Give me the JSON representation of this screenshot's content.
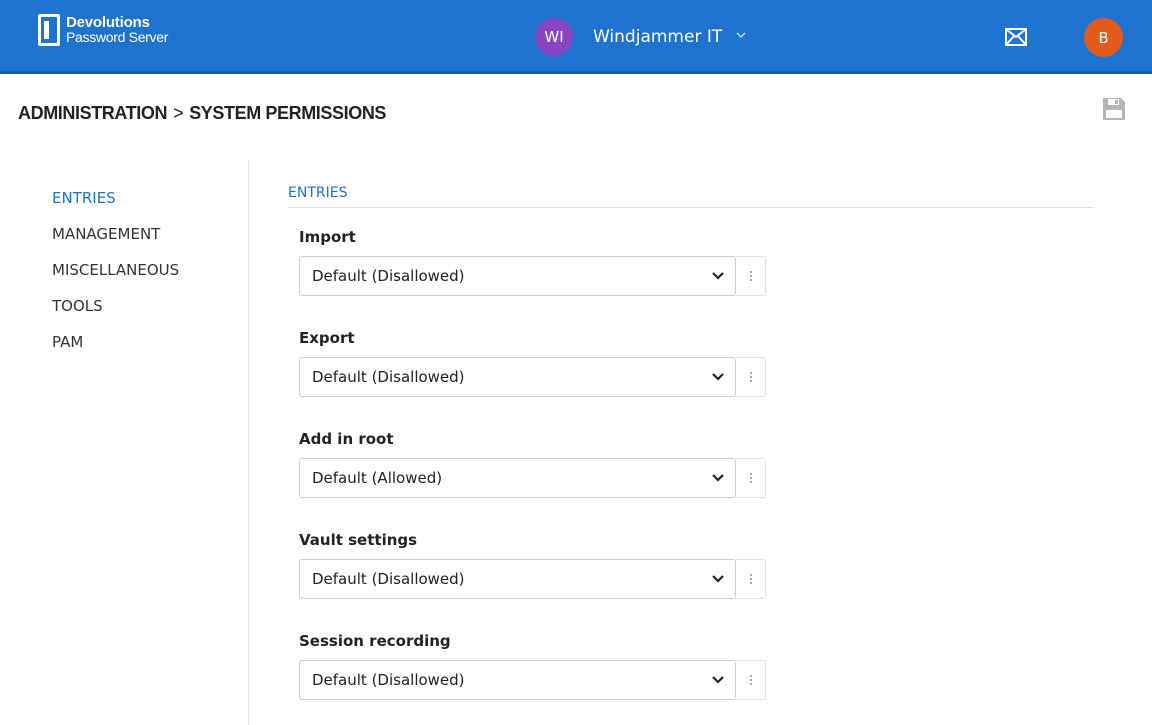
{
  "brand": {
    "line1": "Devolutions",
    "line2": "Password Server"
  },
  "organization": {
    "initials": "WI",
    "name": "Windjammer IT",
    "avatar_color": "#8a44c2"
  },
  "user": {
    "initial": "B",
    "avatar_color": "#e25a1c"
  },
  "colors": {
    "topbar": "#1e73cf",
    "accent": "#1e73cf"
  },
  "breadcrumb": {
    "parent": "ADMINISTRATION",
    "separator": ">",
    "current": "SYSTEM PERMISSIONS"
  },
  "sidenav": {
    "items": [
      {
        "label": "ENTRIES",
        "active": true
      },
      {
        "label": "MANAGEMENT",
        "active": false
      },
      {
        "label": "MISCELLANEOUS",
        "active": false
      },
      {
        "label": "TOOLS",
        "active": false
      },
      {
        "label": "PAM",
        "active": false
      }
    ]
  },
  "section": {
    "title": "ENTRIES",
    "fields": [
      {
        "label": "Import",
        "value": "Default (Disallowed)"
      },
      {
        "label": "Export",
        "value": "Default (Disallowed)"
      },
      {
        "label": "Add in root",
        "value": "Default (Allowed)"
      },
      {
        "label": "Vault settings",
        "value": "Default (Disallowed)"
      },
      {
        "label": "Session recording",
        "value": "Default (Disallowed)"
      }
    ]
  },
  "icons": {
    "mail": "mail-icon",
    "save": "save-icon",
    "org_dropdown": "chevron-down-icon"
  }
}
